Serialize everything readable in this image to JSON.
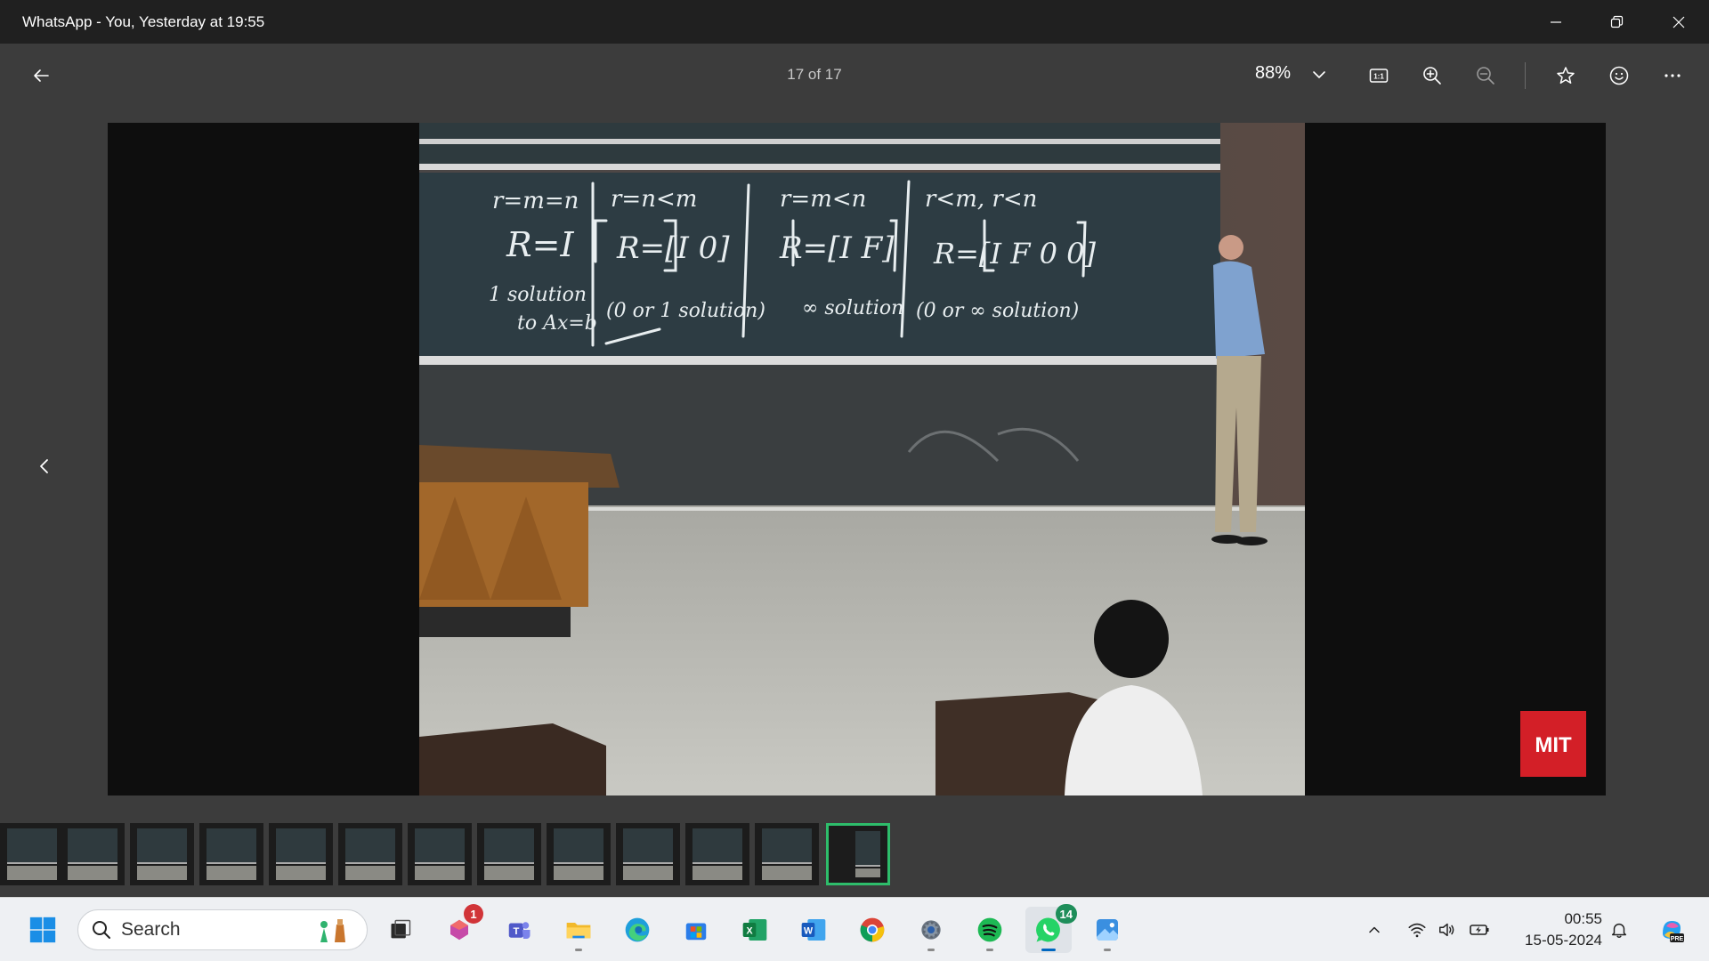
{
  "window": {
    "title": "WhatsApp - You, Yesterday at 19:55"
  },
  "viewer": {
    "counter": "17 of 17",
    "zoom": "88%",
    "actual_size_label": "1:1"
  },
  "photo": {
    "board_text": [
      "r=m=n",
      "R=I",
      "1 solution",
      "to Ax=b",
      "r=n<m",
      "R=[I 0]",
      "(0 or 1 solution)",
      "r=m<n",
      "R=[I F]",
      "∞ solution",
      "r<m, r<n",
      "R=[I F 0 0]",
      "(0 or ∞ solution)"
    ],
    "logo_text": "MIT"
  },
  "filmstrip": {
    "count": 13,
    "active_index": 12
  },
  "taskbar": {
    "search_label": "Search",
    "apps": [
      {
        "name": "file-explorer",
        "badge": ""
      },
      {
        "name": "copilot-app",
        "badge": "1"
      },
      {
        "name": "teams",
        "badge": ""
      },
      {
        "name": "folders",
        "badge": ""
      },
      {
        "name": "edge",
        "badge": ""
      },
      {
        "name": "store",
        "badge": ""
      },
      {
        "name": "excel",
        "badge": ""
      },
      {
        "name": "word",
        "badge": ""
      },
      {
        "name": "chrome",
        "badge": ""
      },
      {
        "name": "settings",
        "badge": ""
      },
      {
        "name": "spotify",
        "badge": ""
      },
      {
        "name": "whatsapp",
        "badge": "14"
      },
      {
        "name": "photos",
        "badge": ""
      }
    ],
    "time": "00:55",
    "date": "15-05-2024"
  },
  "colors": {
    "titlebar": "#202020",
    "toolbar": "#3c3c3c",
    "active_thumb": "#2ebd6b",
    "mit_red": "#d31f27",
    "taskbar": "#eef0f3"
  }
}
